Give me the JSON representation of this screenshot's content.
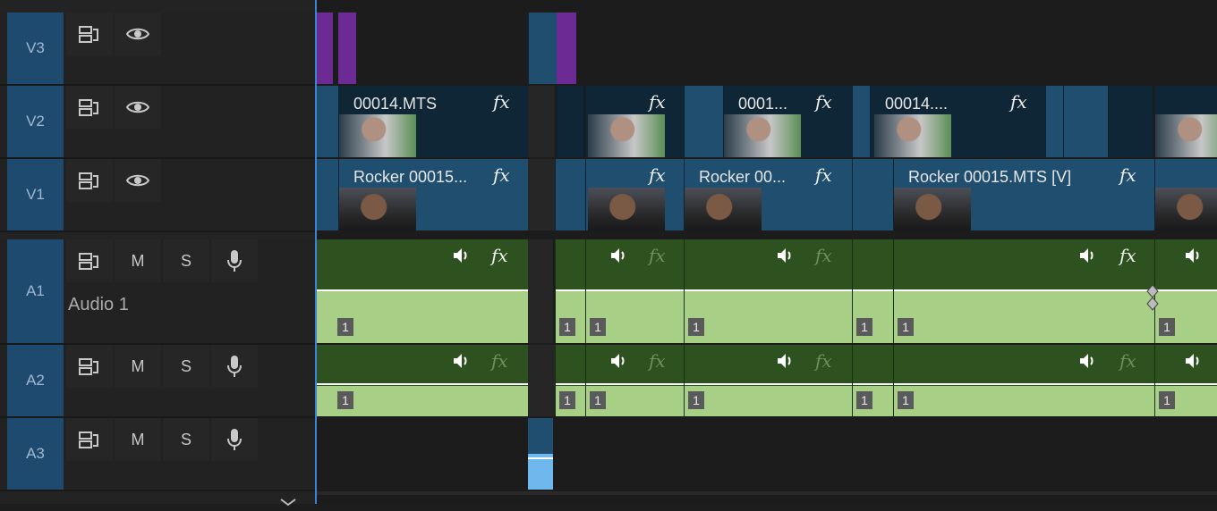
{
  "tracks": {
    "v3": {
      "label": "V3"
    },
    "v2": {
      "label": "V2"
    },
    "v1": {
      "label": "V1"
    },
    "a1": {
      "label": "A1",
      "name": "Audio 1"
    },
    "a2": {
      "label": "A2"
    },
    "a3": {
      "label": "A3"
    }
  },
  "buttons": {
    "mute": "M",
    "solo": "S",
    "fx": "fx"
  },
  "clips": {
    "v2": [
      "00014.MTS",
      "0001...",
      "00014...."
    ],
    "v1": [
      "Rocker 00015...",
      "Rocker 00...",
      "Rocker 00015.MTS [V]"
    ],
    "channel": "1"
  },
  "colors": {
    "target": "#1f4a70",
    "video_clip": "#1f4e6e",
    "audio_clip": "#2d5220",
    "waveform": "#a7cf86",
    "playhead": "#3a84d6",
    "marker": "#6c2a94"
  }
}
